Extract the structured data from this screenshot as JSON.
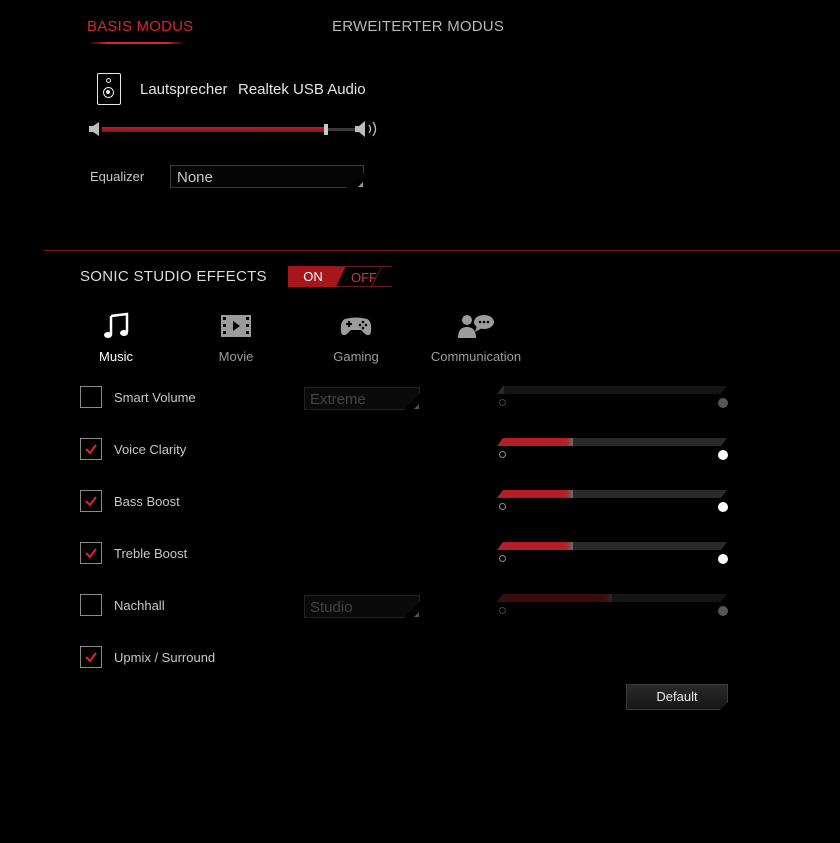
{
  "tabs": {
    "basic": "BASIS MODUS",
    "advanced": "ERWEITERTER MODUS"
  },
  "device": {
    "type_label": "Lautsprecher",
    "name": "Realtek USB Audio",
    "volume_percent": 86
  },
  "equalizer": {
    "label": "Equalizer",
    "value": "None"
  },
  "effects": {
    "title": "SONIC STUDIO EFFECTS",
    "toggle_on": "ON",
    "toggle_off": "OFF",
    "state": "on"
  },
  "modes": [
    {
      "label": "Music",
      "icon": "music-note-icon",
      "active": true
    },
    {
      "label": "Movie",
      "icon": "film-icon",
      "active": false
    },
    {
      "label": "Gaming",
      "icon": "gamepad-icon",
      "active": false
    },
    {
      "label": "Communication",
      "icon": "chat-user-icon",
      "active": false
    }
  ],
  "effect_rows": [
    {
      "label": "Smart Volume",
      "checked": false,
      "preset": "Extreme",
      "level": 0.0
    },
    {
      "label": "Voice Clarity",
      "checked": true,
      "preset": "",
      "level": 0.33
    },
    {
      "label": "Bass Boost",
      "checked": true,
      "preset": "",
      "level": 0.33
    },
    {
      "label": "Treble Boost",
      "checked": true,
      "preset": "",
      "level": 0.33
    },
    {
      "label": "Nachhall",
      "checked": false,
      "preset": "Studio",
      "level": 0.5
    },
    {
      "label": "Upmix / Surround",
      "checked": true,
      "preset": "",
      "level": null
    }
  ],
  "default_button": "Default",
  "colors": {
    "accent": "#d4282c",
    "accent_dark": "#a6161b",
    "background": "#000000"
  }
}
